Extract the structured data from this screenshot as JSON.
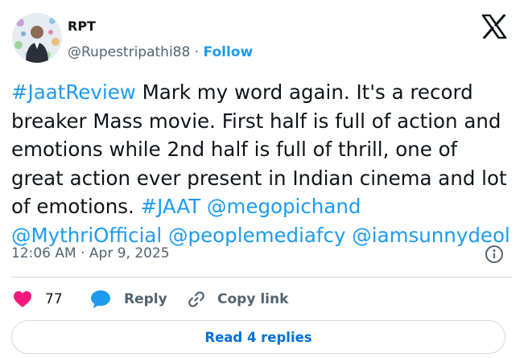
{
  "author": {
    "name": "RPT",
    "handle": "@Rupestripathi88",
    "separator": "·",
    "follow_label": "Follow",
    "avatar_icon": "profile-photo"
  },
  "brand": {
    "logo_icon": "x-logo-icon",
    "color": "#0f1419"
  },
  "tweet": {
    "segments": [
      {
        "text": "#JaatReview",
        "link": true
      },
      {
        "text": " Mark my word again. It's a record breaker Mass movie. First half is full of action and emotions while 2nd half is full of thrill, one of great action ever present in Indian cinema and lot of emotions. ",
        "link": false
      },
      {
        "text": "#JAAT",
        "link": true
      },
      {
        "text": " ",
        "link": false
      },
      {
        "text": "@megopichand",
        "link": true
      },
      {
        "text": " ",
        "link": false
      },
      {
        "text": "@MythriOfficial",
        "link": true
      },
      {
        "text": " ",
        "link": false
      },
      {
        "text": "@peoplemediafcy",
        "link": true
      },
      {
        "text": " ",
        "link": false
      },
      {
        "text": "@iamsunnydeol",
        "link": true
      }
    ],
    "time": "12:06 AM",
    "separator": "·",
    "date": "Apr 9, 2025"
  },
  "actions": {
    "likes": "77",
    "reply_label": "Reply",
    "copy_label": "Copy link"
  },
  "read_replies_label": "Read 4 replies",
  "colors": {
    "link": "#1d9bf0",
    "like": "#f91880",
    "reply": "#1d9bf0",
    "muted": "#536471",
    "border": "#cfd9de",
    "read_button_text": "#006fd6"
  }
}
